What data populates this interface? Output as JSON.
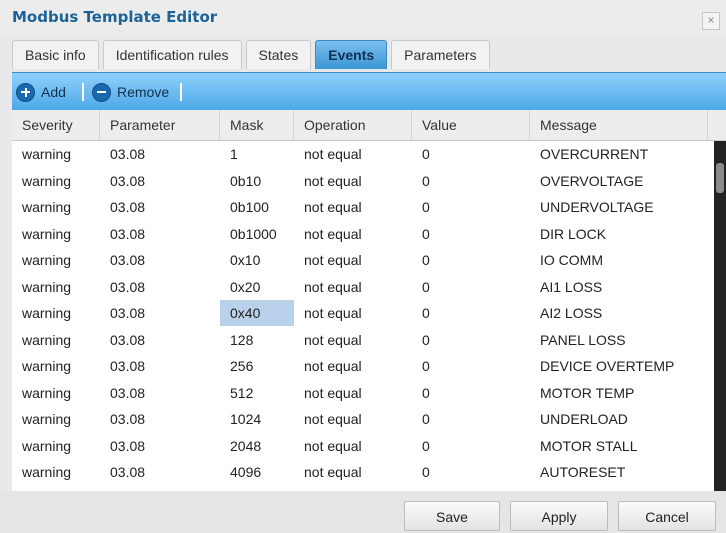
{
  "window": {
    "title": "Modbus Template Editor",
    "close_label": "×"
  },
  "tabs": [
    {
      "label": "Basic info"
    },
    {
      "label": "Identification rules"
    },
    {
      "label": "States"
    },
    {
      "label": "Events",
      "active": true
    },
    {
      "label": "Parameters"
    }
  ],
  "toolbar": {
    "add_label": "Add",
    "remove_label": "Remove",
    "add_icon": "plus-circle",
    "remove_icon": "minus-circle"
  },
  "table": {
    "columns": [
      "Severity",
      "Parameter",
      "Mask",
      "Operation",
      "Value",
      "Message"
    ],
    "rows": [
      [
        "warning",
        "03.08",
        "1",
        "not equal",
        "0",
        "OVERCURRENT"
      ],
      [
        "warning",
        "03.08",
        "0b10",
        "not equal",
        "0",
        "OVERVOLTAGE"
      ],
      [
        "warning",
        "03.08",
        "0b100",
        "not equal",
        "0",
        "UNDERVOLTAGE"
      ],
      [
        "warning",
        "03.08",
        "0b1000",
        "not equal",
        "0",
        "DIR LOCK"
      ],
      [
        "warning",
        "03.08",
        "0x10",
        "not equal",
        "0",
        "IO COMM"
      ],
      [
        "warning",
        "03.08",
        "0x20",
        "not equal",
        "0",
        "AI1 LOSS"
      ],
      [
        "warning",
        "03.08",
        "0x40",
        "not equal",
        "0",
        "AI2 LOSS"
      ],
      [
        "warning",
        "03.08",
        "128",
        "not equal",
        "0",
        "PANEL LOSS"
      ],
      [
        "warning",
        "03.08",
        "256",
        "not equal",
        "0",
        "DEVICE OVERTEMP"
      ],
      [
        "warning",
        "03.08",
        "512",
        "not equal",
        "0",
        "MOTOR TEMP"
      ],
      [
        "warning",
        "03.08",
        "1024",
        "not equal",
        "0",
        "UNDERLOAD"
      ],
      [
        "warning",
        "03.08",
        "2048",
        "not equal",
        "0",
        "MOTOR STALL"
      ],
      [
        "warning",
        "03.08",
        "4096",
        "not equal",
        "0",
        "AUTORESET"
      ]
    ],
    "selected_cell": {
      "row": 6,
      "column": "Mask"
    }
  },
  "footer": {
    "save_label": "Save",
    "apply_label": "Apply",
    "cancel_label": "Cancel"
  },
  "colors": {
    "title": "#1b6397",
    "toolbar": "#4ba7e8",
    "selection": "#b9d1ea"
  }
}
